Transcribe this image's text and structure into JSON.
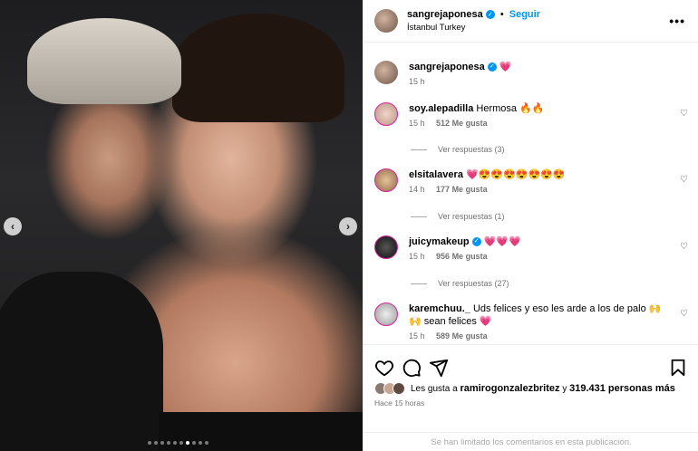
{
  "post": {
    "author": "sangrejaponesa",
    "follow_label": "Seguir",
    "location": "İstanbul Turkey",
    "more_label": "•••",
    "image_nav": {
      "prev": "‹",
      "next": "›",
      "dot_count": 10,
      "active_index": 6
    }
  },
  "caption": {
    "username": "sangrejaponesa",
    "text": "💗",
    "time": "15 h"
  },
  "comments": [
    {
      "username": "soy.alepadilla",
      "text": "Hermosa 🔥🔥",
      "time": "15 h",
      "likes": "512 Me gusta",
      "replies": "Ver respuestas (3)",
      "verified": false
    },
    {
      "username": "elsitalavera",
      "text": "💗😍😍😍😍😍😍😍",
      "time": "14 h",
      "likes": "177 Me gusta",
      "replies": "Ver respuestas (1)",
      "verified": false
    },
    {
      "username": "juicymakeup",
      "text": "💗💗💗",
      "time": "15 h",
      "likes": "956 Me gusta",
      "replies": "Ver respuestas (27)",
      "verified": true
    },
    {
      "username": "karemchuu._",
      "text": "Uds felices y eso les arde a los de palo 🙌🙌 sean felices 💗",
      "time": "15 h",
      "likes": "589 Me gusta",
      "replies": "",
      "verified": false
    }
  ],
  "footer": {
    "liked_by_prefix": "Les gusta a",
    "liked_by_user": "ramirogonzalezbritez",
    "liked_by_connector": "y",
    "liked_by_count": "319.431 personas más",
    "time_ago": "Hace 15 horas",
    "comments_limited": "Se han limitado los comentarios en esta publicación."
  },
  "icons": {
    "like": "heart-icon",
    "comment": "comment-icon",
    "share": "share-icon",
    "save": "bookmark-icon",
    "verified": "verified-badge-icon"
  },
  "colors": {
    "accent": "#0095f6",
    "muted": "#737373",
    "story_ring": "#d6249f"
  }
}
